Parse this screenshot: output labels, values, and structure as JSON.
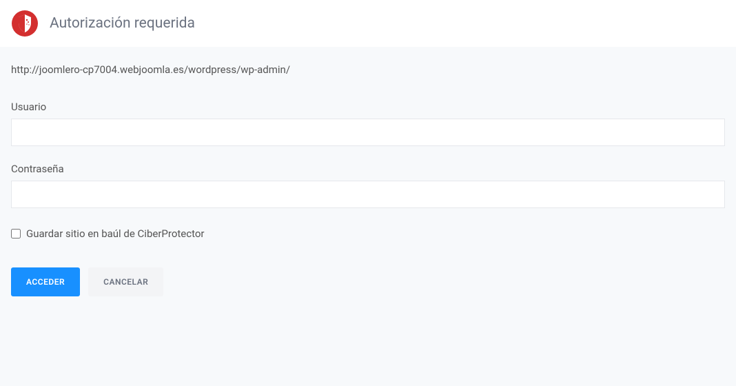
{
  "header": {
    "title": "Autorización requerida"
  },
  "content": {
    "url": "http://joomlero-cp7004.webjoomla.es/wordpress/wp-admin/",
    "username": {
      "label": "Usuario",
      "value": ""
    },
    "password": {
      "label": "Contraseña",
      "value": ""
    },
    "save_checkbox": {
      "label": "Guardar sitio en baúl de CiberProtector",
      "checked": false
    }
  },
  "buttons": {
    "submit": "ACCEDER",
    "cancel": "CANCELAR"
  }
}
